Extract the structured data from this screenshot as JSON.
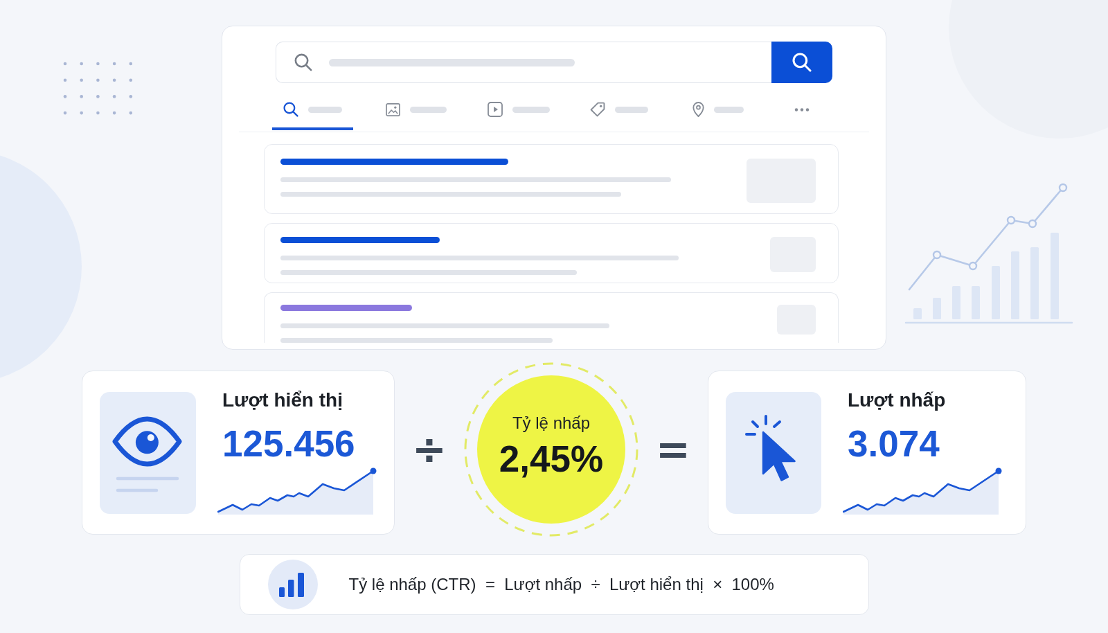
{
  "search_mockup": {
    "tabs": [
      {
        "kind": "search",
        "selected": true
      },
      {
        "kind": "image",
        "selected": false
      },
      {
        "kind": "video",
        "selected": false
      },
      {
        "kind": "tag",
        "selected": false
      },
      {
        "kind": "location",
        "selected": false
      },
      {
        "kind": "more",
        "selected": false
      }
    ],
    "results": [
      {
        "color": "#0b4fd6"
      },
      {
        "color": "#0b4fd6"
      },
      {
        "color": "#8b78de"
      }
    ]
  },
  "metric_equation": {
    "impressions": {
      "label": "Lượt hiển thị",
      "value": "125.456"
    },
    "divide_sign": "÷",
    "click_rate": {
      "label": "Tỷ lệ nhấp",
      "value": "2,45%"
    },
    "equals_sign": "=",
    "clicks": {
      "label": "Lượt nhấp",
      "value": "3.074"
    }
  },
  "formula": {
    "text": "Tỷ lệ nhấp (CTR)  =  Lượt nhấp  ÷  Lượt hiển thị  ×  100%"
  }
}
